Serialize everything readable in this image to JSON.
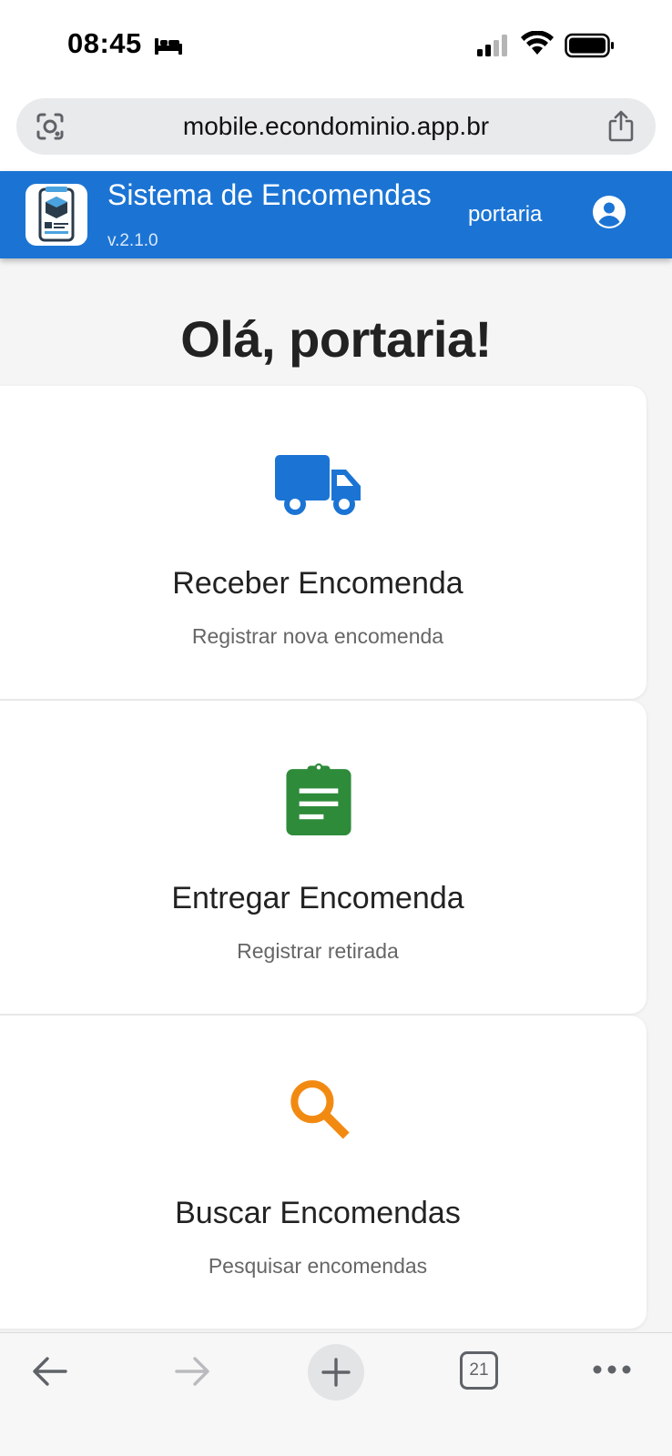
{
  "status_bar": {
    "time": "08:45"
  },
  "browser": {
    "url": "mobile.econdominio.app.br",
    "tab_count": "21"
  },
  "header": {
    "title": "Sistema de Encomendas",
    "version": "v.2.1.0",
    "username": "portaria"
  },
  "main": {
    "greeting": "Olá, portaria!",
    "cards": [
      {
        "title": "Receber Encomenda",
        "subtitle": "Registrar nova encomenda",
        "icon": "truck-icon",
        "color": "#1b74d4"
      },
      {
        "title": "Entregar Encomenda",
        "subtitle": "Registrar retirada",
        "icon": "clipboard-icon",
        "color": "#2e8b3a"
      },
      {
        "title": "Buscar Encomendas",
        "subtitle": "Pesquisar encomendas",
        "icon": "search-icon",
        "color": "#f28a12"
      }
    ]
  },
  "colors": {
    "header_bg": "#1b74d4",
    "page_bg": "#f5f5f5"
  }
}
